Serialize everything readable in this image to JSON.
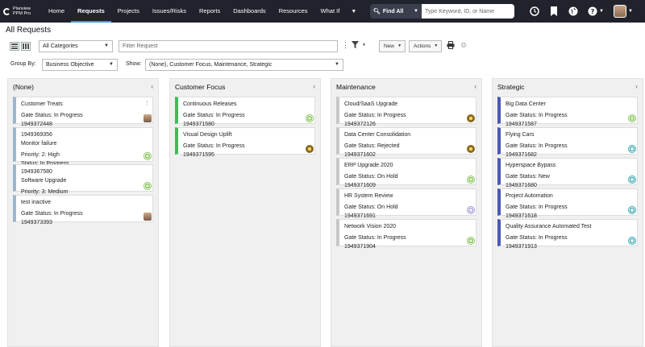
{
  "logo": {
    "line1": "Planview",
    "line2": "PPM Pro"
  },
  "nav": {
    "items": [
      "Home",
      "Requests",
      "Projects",
      "Issues/Risks",
      "Reports",
      "Dashboards",
      "Resources",
      "What If"
    ],
    "active": "Requests"
  },
  "search": {
    "scope": "Find All",
    "placeholder": "Type Keyword, ID, or Name"
  },
  "page": {
    "title": "All Requests"
  },
  "toolbar": {
    "category": "All Categories",
    "filter_placeholder": "Filter Request",
    "new_label": "New",
    "actions_label": "Actions"
  },
  "grouping": {
    "group_by_label": "Group By:",
    "group_by_value": "Business Objective",
    "show_label": "Show:",
    "show_value": "(None), Customer Focus, Maintenance, Strategic"
  },
  "columns": [
    {
      "title": "(None)",
      "cards": [
        {
          "lines": [
            "Customer Treats",
            "",
            "Gate Status: In Progress",
            "1949372448"
          ],
          "bar": "blue",
          "badge": "avatar",
          "kebab": true
        },
        {
          "lines": [
            "1949369356",
            "Monitor failure",
            "",
            "Priority: 2: High",
            "Status: In Progress"
          ],
          "bar": "blue",
          "badge": "green"
        },
        {
          "lines": [
            "1949367580",
            "Software Upgrade",
            "",
            "Priority: 3: Medium"
          ],
          "bar": "blue",
          "badge": "green"
        },
        {
          "lines": [
            "test inactive",
            "",
            "Gate Status: In Progress",
            "1949373393"
          ],
          "bar": "blue",
          "badge": "avatar"
        }
      ]
    },
    {
      "title": "Customer Focus",
      "cards": [
        {
          "lines": [
            "Continuous Releases",
            "",
            "Gate Status: In Progress",
            "1949371580"
          ],
          "bar": "green",
          "badge": "green"
        },
        {
          "lines": [
            "Visual Design Uplift",
            "",
            "Gate Status: In Progress",
            "1949371595"
          ],
          "bar": "green",
          "badge": "gold"
        }
      ]
    },
    {
      "title": "Maintenance",
      "cards": [
        {
          "lines": [
            "Cloud/SaaS Upgrade",
            "",
            "Gate Status: In Progress",
            "1949372126"
          ],
          "bar": "gray",
          "badge": "gold"
        },
        {
          "lines": [
            "Data Center Consolidation",
            "",
            "Gate Status: Rejected",
            "1949371602"
          ],
          "bar": "gray",
          "badge": "gold"
        },
        {
          "lines": [
            "ERP Upgrade 2020",
            "",
            "Gate Status: On Hold",
            "1949371609"
          ],
          "bar": "gray",
          "badge": "green"
        },
        {
          "lines": [
            "HR System Review",
            "",
            "Gate Status: On Hold",
            "1949371691"
          ],
          "bar": "gray",
          "badge": "lav"
        },
        {
          "lines": [
            "Network Vision 2020",
            "",
            "Gate Status: In Progress",
            "1949371904"
          ],
          "bar": "gray",
          "badge": "green"
        }
      ]
    },
    {
      "title": "Strategic",
      "cards": [
        {
          "lines": [
            "Big Data Center",
            "",
            "Gate Status: In Progress",
            "1949371587"
          ],
          "bar": "navy",
          "badge": "green"
        },
        {
          "lines": [
            "Flying Cars",
            "",
            "Gate Status: In Progress",
            "1949371682"
          ],
          "bar": "navy",
          "badge": "teal"
        },
        {
          "lines": [
            "Hyperspace Bypass",
            "",
            "Gate Status: New",
            "1949371680"
          ],
          "bar": "navy",
          "badge": "teal"
        },
        {
          "lines": [
            "Project Automation",
            "",
            "Gate Status: In Progress",
            "1949371618"
          ],
          "bar": "navy",
          "badge": "teal"
        },
        {
          "lines": [
            "Quality Assurance Automated Test",
            "",
            "Gate Status: In Progress",
            "1949371913"
          ],
          "bar": "navy",
          "badge": "teal"
        }
      ]
    }
  ],
  "icons": {
    "nav": [
      "clock-icon",
      "bookmark-icon",
      "globe-icon",
      "help-icon",
      "user-avatar"
    ],
    "toolbar": [
      "list-view-icon",
      "grid-view-icon",
      "kebab-icon",
      "filter-icon",
      "print-icon",
      "gear-icon"
    ]
  }
}
